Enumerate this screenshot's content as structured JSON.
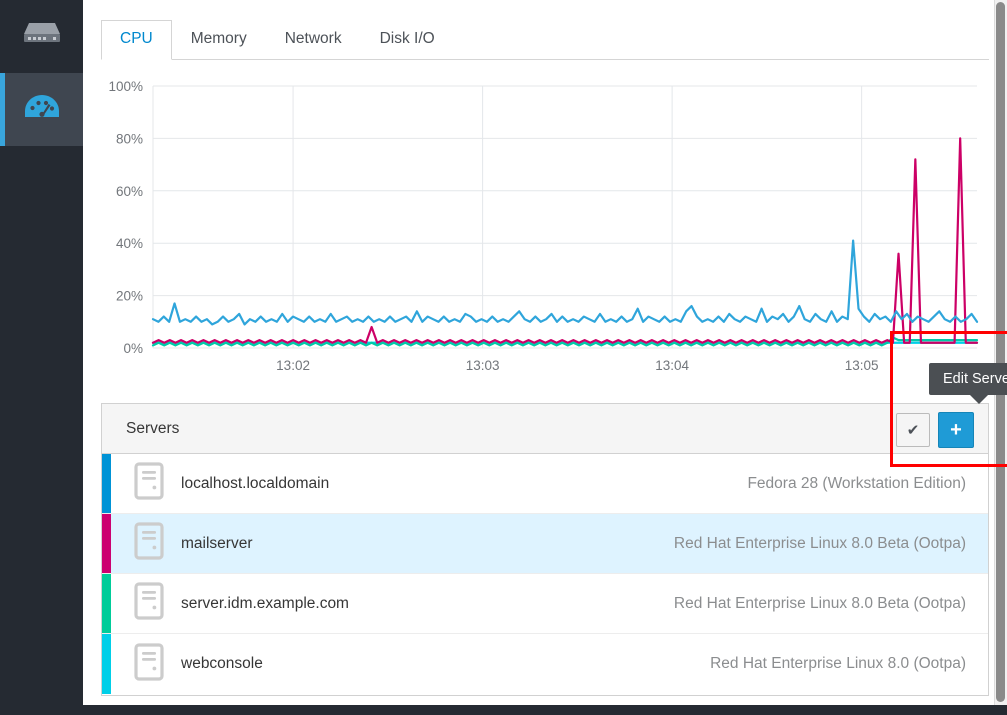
{
  "sidebar": {
    "items": [
      {
        "icon": "server-storage-icon",
        "name": "sidebar-item-servers",
        "active": false
      },
      {
        "icon": "dashboard-gauge-icon",
        "name": "sidebar-item-dashboard",
        "active": true
      }
    ],
    "background_color": "#252a32",
    "active_accent_color": "#39a5dc"
  },
  "tabs": [
    {
      "label": "CPU",
      "active": true
    },
    {
      "label": "Memory",
      "active": false
    },
    {
      "label": "Network",
      "active": false
    },
    {
      "label": "Disk I/O",
      "active": false
    }
  ],
  "card": {
    "title": "Servers",
    "check_button_label": "✔",
    "add_button_label": "+",
    "add_button_color": "#1f9bd6"
  },
  "tooltip": {
    "text": "Edit Server",
    "background": "#4b4f53"
  },
  "annotation": {
    "color": "#ff0000",
    "label": "edit-server-highlight"
  },
  "servers": [
    {
      "name": "localhost.localdomain",
      "os": "Fedora 28 (Workstation Edition)",
      "color": "#0093d6",
      "selected": false
    },
    {
      "name": "mailserver",
      "os": "Red Hat Enterprise Linux 8.0 Beta (Ootpa)",
      "color": "#cc0070",
      "selected": true
    },
    {
      "name": "server.idm.example.com",
      "os": "Red Hat Enterprise Linux 8.0 Beta (Ootpa)",
      "color": "#00cc99",
      "selected": false
    },
    {
      "name": "webconsole",
      "os": "Red Hat Enterprise Linux 8.0 (Ootpa)",
      "color": "#00cfe8",
      "selected": false
    }
  ],
  "chart_data": {
    "type": "line",
    "title": "",
    "xlabel": "",
    "ylabel": "",
    "ylim": [
      0,
      100
    ],
    "ytick_labels": [
      "0%",
      "20%",
      "40%",
      "60%",
      "80%",
      "100%"
    ],
    "ytick_values": [
      0,
      20,
      40,
      60,
      80,
      100
    ],
    "xtick_labels": [
      "13:02",
      "13:03",
      "13:04",
      "13:05"
    ],
    "xtick_positions": [
      0.17,
      0.4,
      0.63,
      0.86
    ],
    "grid": true,
    "legend_position": "none",
    "series": [
      {
        "name": "localhost.localdomain",
        "color": "#2fa5db",
        "values": [
          11,
          10,
          12,
          10,
          17,
          10,
          11,
          10,
          12,
          10,
          11,
          9,
          10,
          12,
          10,
          11,
          13,
          9,
          11,
          10,
          12,
          10,
          11,
          10,
          13,
          10,
          12,
          11,
          10,
          12,
          10,
          11,
          10,
          13,
          10,
          11,
          12,
          10,
          11,
          10,
          12,
          10,
          11,
          10,
          12,
          10,
          11,
          12,
          10,
          14,
          10,
          12,
          11,
          10,
          12,
          10,
          11,
          10,
          13,
          12,
          10,
          11,
          10,
          12,
          10,
          11,
          10,
          12,
          14,
          11,
          10,
          12,
          10,
          11,
          13,
          10,
          12,
          10,
          11,
          10,
          12,
          11,
          10,
          13,
          10,
          11,
          10,
          12,
          10,
          11,
          15,
          10,
          12,
          11,
          10,
          12,
          10,
          11,
          10,
          14,
          16,
          12,
          10,
          11,
          10,
          12,
          10,
          13,
          11,
          10,
          12,
          11,
          10,
          15,
          10,
          12,
          11,
          13,
          10,
          12,
          16,
          11,
          10,
          13,
          11,
          10,
          14,
          10,
          12,
          11,
          41,
          15,
          12,
          10,
          13,
          11,
          12,
          10,
          14,
          11,
          13,
          10,
          12,
          11,
          10,
          12,
          14,
          11,
          10,
          12,
          10,
          11,
          13,
          10
        ]
      },
      {
        "name": "mailserver",
        "color": "#cc0066",
        "values": [
          2,
          3,
          2,
          3,
          2,
          3,
          2,
          3,
          2,
          3,
          2,
          3,
          2,
          3,
          2,
          3,
          2,
          3,
          2,
          3,
          2,
          3,
          2,
          3,
          2,
          3,
          2,
          3,
          2,
          3,
          2,
          3,
          2,
          3,
          2,
          3,
          2,
          3,
          2,
          8,
          2,
          3,
          2,
          3,
          2,
          3,
          2,
          3,
          2,
          3,
          2,
          3,
          2,
          3,
          2,
          3,
          2,
          3,
          2,
          3,
          2,
          3,
          2,
          3,
          2,
          3,
          2,
          3,
          2,
          3,
          2,
          3,
          2,
          3,
          2,
          3,
          2,
          3,
          2,
          3,
          2,
          3,
          2,
          3,
          2,
          3,
          2,
          3,
          2,
          3,
          2,
          3,
          2,
          3,
          2,
          3,
          2,
          3,
          2,
          3,
          2,
          3,
          2,
          3,
          2,
          3,
          2,
          3,
          2,
          3,
          2,
          3,
          2,
          3,
          2,
          3,
          2,
          3,
          2,
          3,
          2,
          3,
          2,
          3,
          2,
          3,
          2,
          3,
          2,
          3,
          2,
          3,
          2,
          36,
          2,
          2,
          72,
          2,
          2,
          2,
          2,
          2,
          2,
          2,
          80,
          2,
          2,
          2
        ]
      },
      {
        "name": "server.idm.example.com",
        "color": "#00c9a7",
        "values": [
          1,
          2,
          1,
          2,
          1,
          2,
          1,
          2,
          1,
          2,
          1,
          2,
          1,
          2,
          1,
          2,
          1,
          2,
          1,
          2,
          1,
          2,
          1,
          2,
          1,
          2,
          1,
          2,
          1,
          2,
          1,
          2,
          1,
          2,
          1,
          2,
          1,
          2,
          1,
          2,
          1,
          2,
          1,
          2,
          1,
          2,
          1,
          2,
          1,
          2,
          1,
          2,
          1,
          2,
          1,
          2,
          1,
          2,
          1,
          2,
          1,
          2,
          1,
          2,
          1,
          2,
          1,
          2,
          1,
          2,
          1,
          2,
          1,
          2,
          1,
          2,
          1,
          2,
          1,
          2,
          1,
          2,
          1,
          2,
          1,
          2,
          1,
          2,
          1,
          2,
          1,
          2,
          1,
          2,
          1,
          2,
          1,
          2,
          1,
          2,
          1,
          2,
          1,
          2,
          1,
          2,
          1,
          2,
          1,
          2,
          1,
          2,
          1,
          2,
          1,
          2,
          1,
          2,
          1,
          2,
          1,
          2,
          1,
          2,
          1,
          2,
          1,
          2,
          1,
          2,
          1,
          2,
          4,
          3,
          3,
          3,
          3,
          3,
          3,
          3,
          3,
          3,
          3,
          3,
          3,
          3,
          3,
          3
        ]
      },
      {
        "name": "webconsole",
        "color": "#00cfe8",
        "values": [
          2,
          2,
          2,
          2,
          2,
          2,
          2,
          2,
          2,
          2,
          2,
          2,
          2,
          2,
          2,
          2,
          2,
          2,
          2,
          2,
          2,
          2,
          2,
          2,
          2,
          2,
          2,
          2,
          2,
          2,
          2,
          2,
          2,
          2,
          2,
          2,
          2,
          2,
          2,
          2,
          2,
          2,
          2,
          2,
          2,
          2,
          2,
          2,
          2,
          2,
          2,
          2,
          2,
          2,
          2,
          2,
          2,
          2,
          2,
          2,
          2,
          2,
          2,
          2,
          2,
          2,
          2,
          2,
          2,
          2,
          2,
          2,
          2,
          2,
          2,
          2,
          2,
          2,
          2,
          2,
          2,
          2,
          2,
          2,
          2,
          2,
          2,
          2,
          2,
          2,
          2,
          2,
          2,
          2,
          2,
          2,
          2,
          2,
          2,
          2,
          2,
          2,
          2,
          2,
          2,
          2,
          2,
          2,
          2,
          2,
          2,
          2,
          2,
          2,
          2,
          2,
          2,
          2,
          2,
          2,
          2,
          2,
          2,
          2,
          2,
          2,
          2,
          2,
          2,
          2,
          2,
          2,
          2,
          2,
          2,
          2,
          2,
          2,
          2,
          2,
          2,
          2,
          2,
          2,
          2,
          2,
          2,
          2
        ]
      }
    ]
  }
}
